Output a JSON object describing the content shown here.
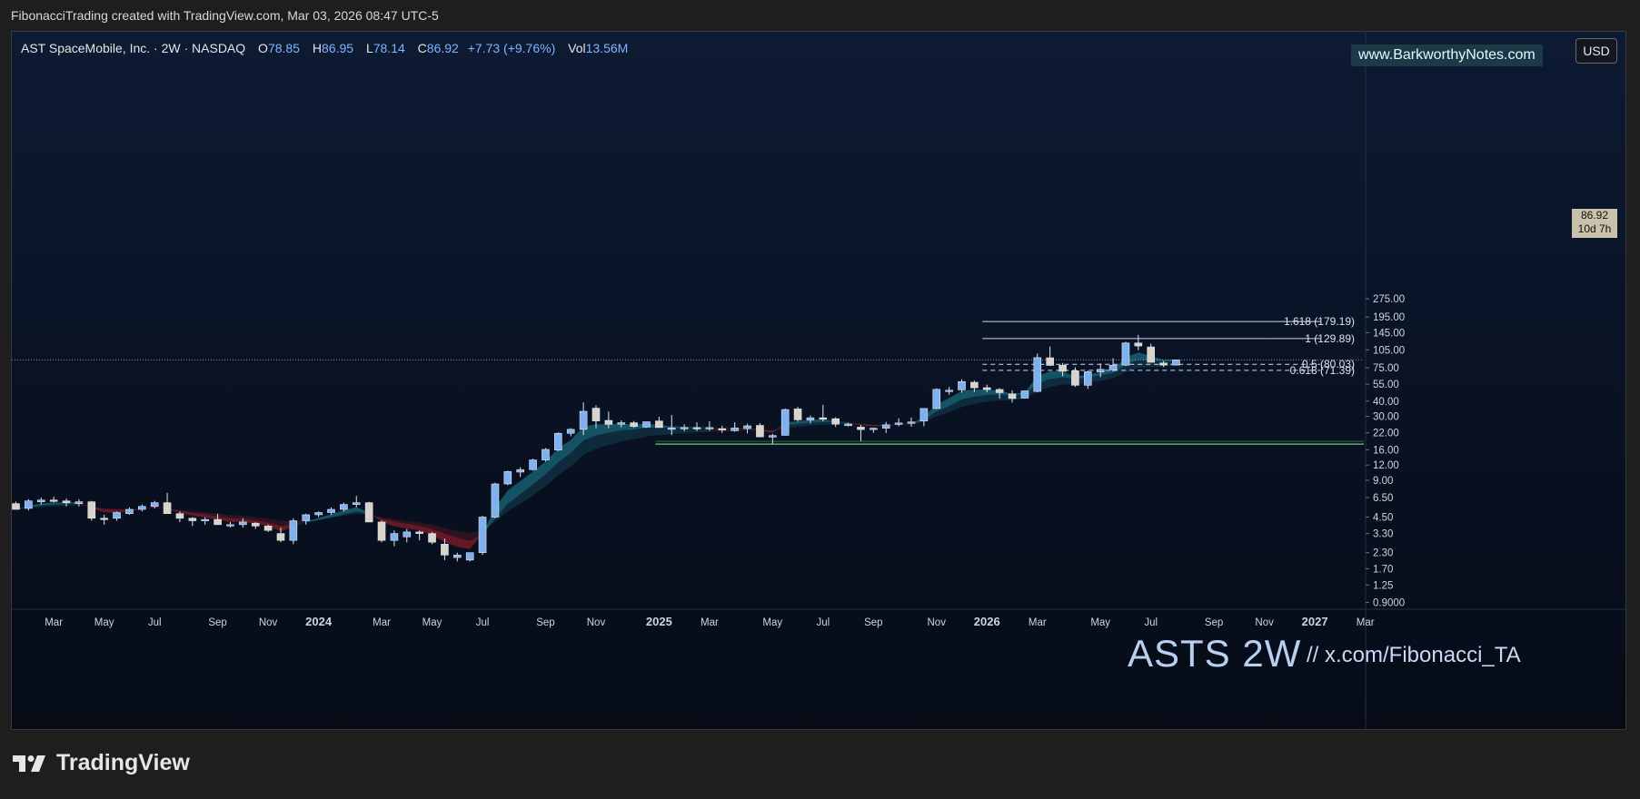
{
  "header": {
    "caption": "FibonacciTrading created with TradingView.com, Mar 03, 2026 08:47 UTC-5"
  },
  "legend": {
    "symbol": "AST SpaceMobile, Inc. · 2W · NASDAQ",
    "o_label": "O",
    "o_value": "78.85",
    "h_label": "H",
    "h_value": "86.95",
    "l_label": "L",
    "l_value": "78.14",
    "c_label": "C",
    "c_value": "86.92",
    "change": "+7.73 (+9.76%)",
    "vol_label": "Vol",
    "vol_value": "13.56M"
  },
  "watermark": {
    "url": "www.BarkworthyNotes.com",
    "title": "ASTS 2W",
    "handle": "//  x.com/Fibonacci_TA"
  },
  "currency": "USD",
  "last_price": {
    "price": "86.92",
    "countdown": "10d 7h"
  },
  "footer": {
    "brand": "TradingView"
  },
  "colors": {
    "bull": "#7fb0f0",
    "bear": "#d9d4c9",
    "band_teal": "#1f8a9a",
    "band_red": "#b3232c",
    "fib_line": "#cfd8e6",
    "support": "#5fae6d",
    "background_top": "#0d1a33",
    "background_bottom": "#060b16"
  },
  "chart_data": {
    "type": "candlestick",
    "title": "AST SpaceMobile, Inc. · 2W · NASDAQ",
    "y_scale": "log",
    "ylim": [
      0.8,
      330
    ],
    "y_ticks": [
      0.9,
      1.25,
      1.7,
      2.3,
      3.3,
      4.5,
      6.5,
      9.0,
      12.0,
      16.0,
      22.0,
      30.0,
      40.0,
      55.0,
      75.0,
      105.0,
      145.0,
      195.0,
      275.0
    ],
    "y_tick_labels": [
      "0.9000",
      "1.25",
      "1.70",
      "2.30",
      "3.30",
      "4.50",
      "6.50",
      "9.00",
      "12.00",
      "16.00",
      "22.00",
      "30.00",
      "40.00",
      "55.00",
      "75.00",
      "105.00",
      "145.00",
      "195.00",
      "275.00"
    ],
    "x_tick_labels": [
      {
        "label": "Mar",
        "bar": 3
      },
      {
        "label": "May",
        "bar": 7
      },
      {
        "label": "Jul",
        "bar": 11
      },
      {
        "label": "Sep",
        "bar": 16
      },
      {
        "label": "Nov",
        "bar": 20
      },
      {
        "label": "2024",
        "bar": 24
      },
      {
        "label": "Mar",
        "bar": 29
      },
      {
        "label": "May",
        "bar": 33
      },
      {
        "label": "Jul",
        "bar": 37
      },
      {
        "label": "Sep",
        "bar": 42
      },
      {
        "label": "Nov",
        "bar": 46
      },
      {
        "label": "2025",
        "bar": 51
      },
      {
        "label": "Mar",
        "bar": 55
      },
      {
        "label": "May",
        "bar": 60
      },
      {
        "label": "Jul",
        "bar": 64
      },
      {
        "label": "Sep",
        "bar": 68
      },
      {
        "label": "Nov",
        "bar": 73
      },
      {
        "label": "2026",
        "bar": 77
      },
      {
        "label": "Mar",
        "bar": 81
      },
      {
        "label": "May",
        "bar": 86
      },
      {
        "label": "Jul",
        "bar": 90
      },
      {
        "label": "Sep",
        "bar": 95
      },
      {
        "label": "Nov",
        "bar": 99
      },
      {
        "label": "2027",
        "bar": 103
      },
      {
        "label": "Mar",
        "bar": 107
      }
    ],
    "candles": [
      [
        5.8,
        6.0,
        5.2,
        5.2
      ],
      [
        5.3,
        6.3,
        5.1,
        6.1
      ],
      [
        6.0,
        6.5,
        5.7,
        6.2
      ],
      [
        6.2,
        6.6,
        5.9,
        6.1
      ],
      [
        6.1,
        6.4,
        5.5,
        5.9
      ],
      [
        5.8,
        6.3,
        5.5,
        6.0
      ],
      [
        6.0,
        6.1,
        4.2,
        4.4
      ],
      [
        4.4,
        4.7,
        3.9,
        4.3
      ],
      [
        4.4,
        5.0,
        4.2,
        4.9
      ],
      [
        4.8,
        5.4,
        4.7,
        5.2
      ],
      [
        5.2,
        5.7,
        5.0,
        5.5
      ],
      [
        5.5,
        6.1,
        5.3,
        5.9
      ],
      [
        5.9,
        7.1,
        5.5,
        4.8
      ],
      [
        4.8,
        5.0,
        4.1,
        4.4
      ],
      [
        4.4,
        4.5,
        3.8,
        4.2
      ],
      [
        4.2,
        4.5,
        3.9,
        4.3
      ],
      [
        4.3,
        4.8,
        4.0,
        3.9
      ],
      [
        3.9,
        4.1,
        3.7,
        3.9
      ],
      [
        3.9,
        4.4,
        3.7,
        4.1
      ],
      [
        4.0,
        4.1,
        3.6,
        3.8
      ],
      [
        3.8,
        3.9,
        3.4,
        3.5
      ],
      [
        3.3,
        3.7,
        2.8,
        2.9
      ],
      [
        2.9,
        4.4,
        2.7,
        4.2
      ],
      [
        4.2,
        4.8,
        3.9,
        4.7
      ],
      [
        4.7,
        5.0,
        4.5,
        4.9
      ],
      [
        4.9,
        5.4,
        4.7,
        5.2
      ],
      [
        5.2,
        5.9,
        5.0,
        5.7
      ],
      [
        5.7,
        6.7,
        5.4,
        5.9
      ],
      [
        5.9,
        6.0,
        4.1,
        4.1
      ],
      [
        4.1,
        4.2,
        2.8,
        2.9
      ],
      [
        2.9,
        3.5,
        2.6,
        3.3
      ],
      [
        3.1,
        3.6,
        2.8,
        3.4
      ],
      [
        3.4,
        3.5,
        2.9,
        3.3
      ],
      [
        3.3,
        3.4,
        2.7,
        2.8
      ],
      [
        2.7,
        3.0,
        2.0,
        2.2
      ],
      [
        2.1,
        2.3,
        1.95,
        2.2
      ],
      [
        2.0,
        2.3,
        1.95,
        2.3
      ],
      [
        2.3,
        4.6,
        2.2,
        4.5
      ],
      [
        4.5,
        8.6,
        4.4,
        8.4
      ],
      [
        8.4,
        10.8,
        8.2,
        10.6
      ],
      [
        10.5,
        11.5,
        9.6,
        11.0
      ],
      [
        11.0,
        13.5,
        10.8,
        13.2
      ],
      [
        13.2,
        16.5,
        12.8,
        16.1
      ],
      [
        15.9,
        22.2,
        15.6,
        21.8
      ],
      [
        21.8,
        24.0,
        20.6,
        23.5
      ],
      [
        23.5,
        39.1,
        21.1,
        33.0
      ],
      [
        35.0,
        37.0,
        24.0,
        27.5
      ],
      [
        27.8,
        32.8,
        24.0,
        25.8
      ],
      [
        25.9,
        27.8,
        24.4,
        26.6
      ],
      [
        26.6,
        27.5,
        24.2,
        24.8
      ],
      [
        24.5,
        27.1,
        24.2,
        27.1
      ],
      [
        27.5,
        29.8,
        24.3,
        24.3
      ],
      [
        24.0,
        30.8,
        21.1,
        24.1
      ],
      [
        24.0,
        25.8,
        22.6,
        24.3
      ],
      [
        24.3,
        26.8,
        22.7,
        24.0
      ],
      [
        23.8,
        27.4,
        22.8,
        24.3
      ],
      [
        23.8,
        25.2,
        22.0,
        23.4
      ],
      [
        22.9,
        26.8,
        22.5,
        24.1
      ],
      [
        23.8,
        26.1,
        21.8,
        25.1
      ],
      [
        25.3,
        26.4,
        20.2,
        20.4
      ],
      [
        20.3,
        21.6,
        17.8,
        20.9
      ],
      [
        21.0,
        34.8,
        20.9,
        34.1
      ],
      [
        34.5,
        35.9,
        27.1,
        28.1
      ],
      [
        28.0,
        30.5,
        26.2,
        29.2
      ],
      [
        29.2,
        37.3,
        27.2,
        28.7
      ],
      [
        28.7,
        29.5,
        24.6,
        25.9
      ],
      [
        25.2,
        26.6,
        24.8,
        26.0
      ],
      [
        24.5,
        25.5,
        18.8,
        23.4
      ],
      [
        23.4,
        24.3,
        22.0,
        24.0
      ],
      [
        24.0,
        27.0,
        21.9,
        25.6
      ],
      [
        25.8,
        28.9,
        24.9,
        26.5
      ],
      [
        26.5,
        29.4,
        24.7,
        27.0
      ],
      [
        27.5,
        34.4,
        24.9,
        34.8
      ],
      [
        34.8,
        51.0,
        34.4,
        49.9
      ],
      [
        48.1,
        52.3,
        45.1,
        49.1
      ],
      [
        49.4,
        60.4,
        47.0,
        57.8
      ],
      [
        57.0,
        58.8,
        47.5,
        51.4
      ],
      [
        51.5,
        54.6,
        47.2,
        49.7
      ],
      [
        49.8,
        51.1,
        41.8,
        46.9
      ],
      [
        45.8,
        49.0,
        38.9,
        42.0
      ],
      [
        42.3,
        49.0,
        42.1,
        48.5
      ],
      [
        48.0,
        98.0,
        47.1,
        90.7
      ],
      [
        90.5,
        112.0,
        77.5,
        78.4
      ],
      [
        78.6,
        82.0,
        64.0,
        70.2
      ],
      [
        70.8,
        75.6,
        52.3,
        53.9
      ],
      [
        53.9,
        71.0,
        50.4,
        69.5
      ],
      [
        69.4,
        81.4,
        62.8,
        72.7
      ],
      [
        72.2,
        89.7,
        69.9,
        78.6
      ],
      [
        78.8,
        122.2,
        77.5,
        119.5
      ],
      [
        119.6,
        139.2,
        104.2,
        113.0
      ],
      [
        111.0,
        118.0,
        83.0,
        83.1
      ],
      [
        82.0,
        85.2,
        76.0,
        78.8
      ],
      [
        78.85,
        86.95,
        78.14,
        86.92
      ]
    ],
    "bands": {
      "ema_upper_last": 80.0,
      "ema_lower_last": 55.0
    },
    "fib_levels": [
      {
        "label": "1.618 (179.19)",
        "value": 179.19
      },
      {
        "label": "1 (129.89)",
        "value": 129.89
      },
      {
        "label": "0.5 (80.03)",
        "value": 80.03
      },
      {
        "label": "0.618 (71.39)",
        "value": 71.39
      }
    ],
    "support_level": 17.8,
    "last_close": 86.92
  }
}
